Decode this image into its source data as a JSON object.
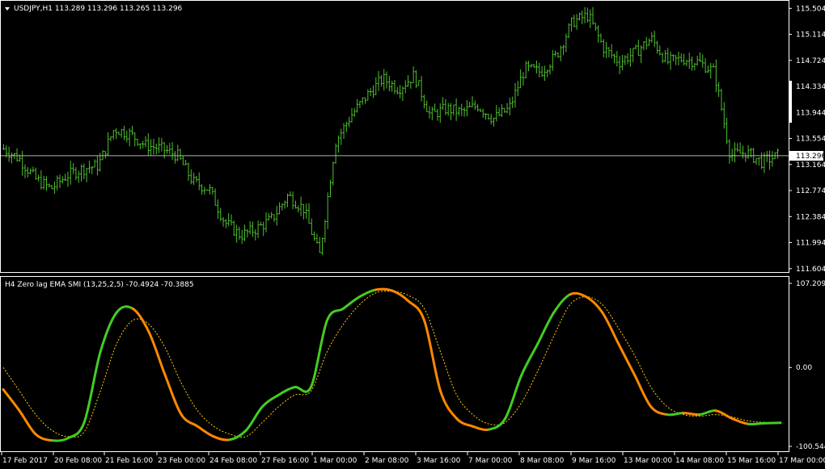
{
  "price_panel": {
    "symbol_info": "USDJPY,H1  113.289 113.296 113.265 113.296",
    "current_price": "113.296",
    "current_price_value": 113.296
  },
  "indicator_panel": {
    "label": "H4 Zero lag EMA SMI (13,25,2,5) -70.4924 -70.3885"
  },
  "chart_data": [
    {
      "type": "ohlc",
      "title": "USDJPY,H1",
      "ylim": [
        111.553,
        115.532
      ],
      "yticks": [
        "115.504",
        "115.114",
        "114.724",
        "114.334",
        "113.944",
        "113.554",
        "113.164",
        "112.774",
        "112.384",
        "111.994",
        "111.604"
      ],
      "ytick_values": [
        115.504,
        115.114,
        114.724,
        114.334,
        113.944,
        113.554,
        113.164,
        112.774,
        112.384,
        111.994,
        111.604
      ],
      "x": [
        "17 Feb 2017",
        "20 Feb 08:00",
        "21 Feb 16:00",
        "23 Feb 00:00",
        "24 Feb 08:00",
        "27 Feb 16:00",
        "1 Mar 00:00",
        "2 Mar 08:00",
        "3 Mar 16:00",
        "7 Mar 00:00",
        "8 Mar 08:00",
        "9 Mar 16:00",
        "13 Mar 00:00",
        "14 Mar 08:00",
        "15 Mar 16:00",
        "17 Mar 00:00"
      ],
      "close_path": [
        [
          "17 Feb 2017",
          113.4
        ],
        [
          "18 Feb",
          113.25
        ],
        [
          "19 Feb",
          112.95
        ],
        [
          "19 Feb 12:00",
          112.8
        ],
        [
          "20 Feb 08:00",
          113.0
        ],
        [
          "20 Feb 16:00",
          113.1
        ],
        [
          "21 Feb 00:00",
          113.15
        ],
        [
          "21 Feb 08:00",
          113.7
        ],
        [
          "21 Feb 16:00",
          113.62
        ],
        [
          "22 Feb 00:00",
          113.45
        ],
        [
          "22 Feb 12:00",
          113.4
        ],
        [
          "23 Feb 00:00",
          113.3
        ],
        [
          "23 Feb 12:00",
          112.9
        ],
        [
          "24 Feb 00:00",
          112.8
        ],
        [
          "24 Feb 08:00",
          112.3
        ],
        [
          "24 Feb 16:00",
          112.1
        ],
        [
          "27 Feb 00:00",
          112.2
        ],
        [
          "27 Feb 08:00",
          112.35
        ],
        [
          "27 Feb 16:00",
          112.7
        ],
        [
          "28 Feb 00:00",
          112.5
        ],
        [
          "28 Feb 12:00",
          111.8
        ],
        [
          "1 Mar 00:00",
          113.5
        ],
        [
          "1 Mar 12:00",
          113.9
        ],
        [
          "2 Mar 00:00",
          114.2
        ],
        [
          "2 Mar 08:00",
          114.45
        ],
        [
          "2 Mar 16:00",
          114.3
        ],
        [
          "3 Mar 00:00",
          114.5
        ],
        [
          "3 Mar 16:00",
          113.9
        ],
        [
          "6 Mar 00:00",
          114.0
        ],
        [
          "6 Mar 12:00",
          113.95
        ],
        [
          "7 Mar 00:00",
          114.05
        ],
        [
          "7 Mar 12:00",
          113.85
        ],
        [
          "8 Mar 00:00",
          114.0
        ],
        [
          "8 Mar 08:00",
          114.6
        ],
        [
          "8 Mar 16:00",
          114.55
        ],
        [
          "9 Mar 00:00",
          114.8
        ],
        [
          "9 Mar 16:00",
          115.3
        ],
        [
          "10 Mar 00:00",
          115.4
        ],
        [
          "10 Mar 12:00",
          114.9
        ],
        [
          "13 Mar 00:00",
          114.7
        ],
        [
          "13 Mar 08:00",
          114.85
        ],
        [
          "13 Mar 16:00",
          115.05
        ],
        [
          "14 Mar 00:00",
          114.7
        ],
        [
          "14 Mar 08:00",
          114.75
        ],
        [
          "15 Mar 00:00",
          114.7
        ],
        [
          "15 Mar 08:00",
          114.55
        ],
        [
          "15 Mar 16:00",
          113.3
        ],
        [
          "16 Mar 00:00",
          113.35
        ],
        [
          "16 Mar 12:00",
          113.2
        ],
        [
          "17 Mar 00:00",
          113.296
        ]
      ],
      "close_path_min": 111.7,
      "close_path_max": 115.45
    },
    {
      "type": "line",
      "title": "H4 Zero lag EMA SMI (13,25,2,5)",
      "ylim": [
        -100.544,
        107.2091
      ],
      "yticks": [
        "107.2091",
        "0.00",
        "-100.544"
      ],
      "ytick_values": [
        107.2091,
        0,
        -100.544
      ],
      "x": [
        "17 Feb 2017",
        "18 Feb",
        "19 Feb",
        "20 Feb 08:00",
        "20 Feb 16:00",
        "21 Feb 00:00",
        "21 Feb 08:00",
        "21 Feb 16:00",
        "22 Feb 00:00",
        "22 Feb 12:00",
        "23 Feb 00:00",
        "23 Feb 12:00",
        "24 Feb 00:00",
        "24 Feb 08:00",
        "24 Feb 16:00",
        "27 Feb 00:00",
        "27 Feb 08:00",
        "27 Feb 16:00",
        "28 Feb 00:00",
        "28 Feb 12:00",
        "1 Mar 00:00",
        "1 Mar 12:00",
        "2 Mar 00:00",
        "2 Mar 08:00",
        "2 Mar 16:00",
        "3 Mar 00:00",
        "3 Mar 16:00",
        "6 Mar 00:00",
        "6 Mar 12:00",
        "7 Mar 00:00",
        "7 Mar 12:00",
        "8 Mar 00:00",
        "8 Mar 08:00",
        "8 Mar 16:00",
        "9 Mar 00:00",
        "9 Mar 16:00",
        "10 Mar 00:00",
        "10 Mar 12:00",
        "13 Mar 00:00",
        "13 Mar 08:00",
        "13 Mar 16:00",
        "14 Mar 00:00",
        "14 Mar 08:00",
        "15 Mar 00:00",
        "15 Mar 08:00",
        "15 Mar 16:00",
        "16 Mar 00:00",
        "16 Mar 12:00",
        "17 Mar 00:00"
      ],
      "series": [
        {
          "color_up": "#44cc22",
          "color_down": "#ff8800",
          "values": [
            -28,
            -55,
            -85,
            -93,
            -90,
            -70,
            20,
            70,
            75,
            45,
            -10,
            -60,
            -75,
            -88,
            -92,
            -80,
            -50,
            -35,
            -25,
            -25,
            60,
            75,
            90,
            99,
            98,
            85,
            60,
            -30,
            -65,
            -75,
            -79,
            -65,
            -10,
            30,
            70,
            93,
            90,
            70,
            30,
            -10,
            -50,
            -60,
            -58,
            -60,
            -55,
            -65,
            -72,
            -71,
            -70.4924
          ]
        },
        {
          "color": "#ffcc00",
          "style": "dotted",
          "values": [
            0,
            -30,
            -60,
            -80,
            -88,
            -82,
            -30,
            30,
            60,
            55,
            25,
            -20,
            -55,
            -75,
            -85,
            -88,
            -70,
            -50,
            -35,
            -30,
            20,
            55,
            80,
            95,
            97,
            92,
            75,
            20,
            -35,
            -60,
            -72,
            -70,
            -45,
            -5,
            40,
            80,
            90,
            80,
            50,
            15,
            -25,
            -50,
            -60,
            -62,
            -60,
            -63,
            -68,
            -70,
            -70.3885
          ]
        }
      ]
    }
  ]
}
